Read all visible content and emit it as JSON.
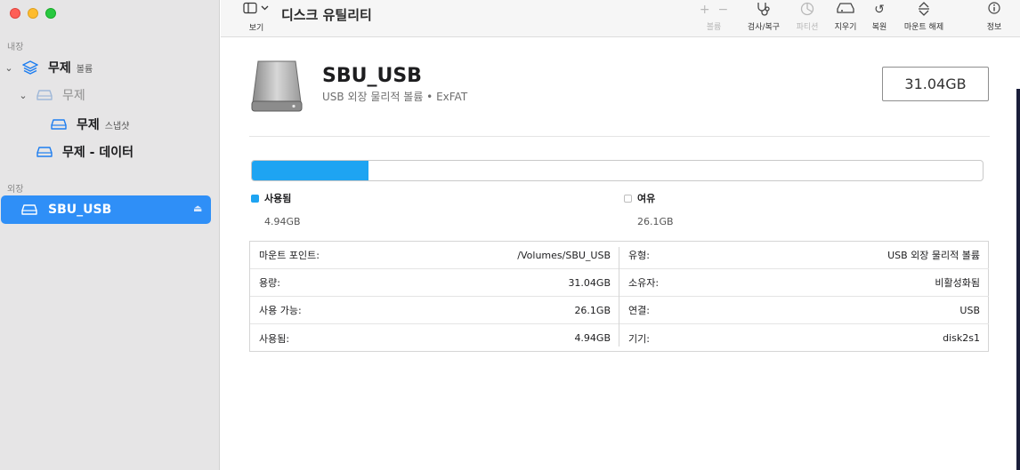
{
  "window": {
    "title": "디스크 유틸리티"
  },
  "toolbar": {
    "view_label": "보기",
    "items": [
      {
        "name": "volume",
        "label": "볼륨",
        "disabled": true
      },
      {
        "name": "first-aid",
        "label": "검사/복구",
        "disabled": false
      },
      {
        "name": "partition",
        "label": "파티션",
        "disabled": true
      },
      {
        "name": "erase",
        "label": "지우기",
        "disabled": false
      },
      {
        "name": "restore",
        "label": "복원",
        "disabled": false
      },
      {
        "name": "unmount",
        "label": "마운트 해제",
        "disabled": false
      },
      {
        "name": "info",
        "label": "정보",
        "disabled": false
      }
    ]
  },
  "sidebar": {
    "internal_label": "내장",
    "external_label": "외장",
    "items": [
      {
        "label": "무제",
        "sub": "볼륨"
      },
      {
        "label": "무제"
      },
      {
        "label": "무제",
        "sub": "스냅샷"
      },
      {
        "label": "무제 - 데이터"
      },
      {
        "label": "SBU_USB"
      }
    ]
  },
  "volume": {
    "name": "SBU_USB",
    "subtitle": "USB 외장 물리적 볼륨 • ExFAT",
    "capacity": "31.04GB",
    "used_fraction": 0.159
  },
  "legend": {
    "used": {
      "label": "사용됨",
      "value": "4.94GB",
      "color": "#1ea4f2"
    },
    "free": {
      "label": "여유",
      "value": "26.1GB"
    }
  },
  "info": {
    "left": [
      {
        "k": "마운트 포인트:",
        "v": "/Volumes/SBU_USB"
      },
      {
        "k": "용량:",
        "v": "31.04GB"
      },
      {
        "k": "사용 가능:",
        "v": "26.1GB"
      },
      {
        "k": "사용됨:",
        "v": "4.94GB"
      }
    ],
    "right": [
      {
        "k": "유형:",
        "v": "USB 외장 물리적 볼륨"
      },
      {
        "k": "소유자:",
        "v": "비활성화됨"
      },
      {
        "k": "연결:",
        "v": "USB"
      },
      {
        "k": "기기:",
        "v": "disk2s1"
      }
    ]
  }
}
